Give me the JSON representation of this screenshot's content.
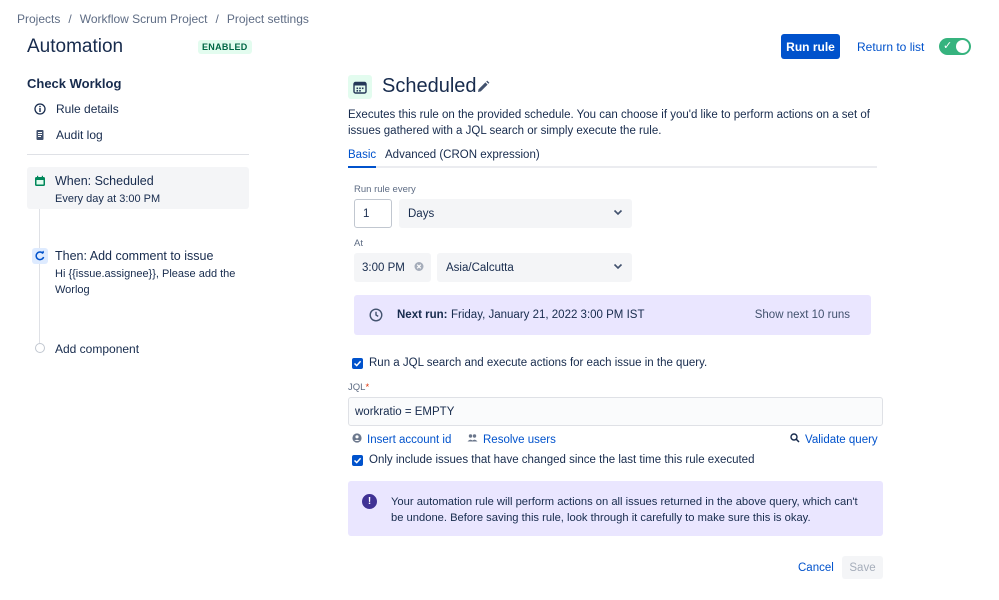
{
  "breadcrumb": [
    "Projects",
    "Workflow Scrum Project",
    "Project settings"
  ],
  "header": {
    "title": "Automation",
    "badge": "ENABLED",
    "run_rule": "Run rule",
    "return_to_list": "Return to list",
    "toggle_on": true
  },
  "sidebar": {
    "rule_name": "Check Worklog",
    "links": [
      {
        "label": "Rule details",
        "icon": "info-icon"
      },
      {
        "label": "Audit log",
        "icon": "document-icon"
      }
    ],
    "steps": [
      {
        "title": "When: Scheduled",
        "subtitle": "Every day at 3:00 PM",
        "icon": "calendar-icon"
      },
      {
        "title": "Then: Add comment to issue",
        "subtitle": "Hi {{issue.assignee}}, Please add the Worlog",
        "icon": "comment-refresh-icon"
      }
    ],
    "add_component": "Add component"
  },
  "main": {
    "title": "Scheduled",
    "description": "Executes this rule on the provided schedule. You can choose if you'd like to perform actions on a set of issues gathered with a JQL search or simply execute the rule.",
    "tabs": [
      {
        "label": "Basic",
        "active": true
      },
      {
        "label": "Advanced (CRON expression)",
        "active": false
      }
    ],
    "run_every_label": "Run rule every",
    "run_every_value": "1",
    "run_every_unit": "Days",
    "at_label": "At",
    "at_time": "3:00 PM",
    "timezone": "Asia/Calcutta",
    "next_run": {
      "label": "Next run:",
      "value": "Friday, January 21, 2022 3:00 PM IST",
      "show_next": "Show next 10 runs"
    },
    "jql_checkbox": "Run a JQL search and execute actions for each issue in the query.",
    "jql_label": "JQL",
    "jql_required": "*",
    "jql_value": "workratio = EMPTY",
    "insert_account_id": "Insert account id",
    "resolve_users": "Resolve users",
    "validate_query": "Validate query",
    "only_changed_checkbox": "Only include issues that have changed since the last time this rule executed",
    "warning": "Your automation rule will perform actions on all issues returned in the above query, which can't be undone. Before saving this rule, look through it carefully to make sure this is okay.",
    "cancel": "Cancel",
    "save": "Save"
  },
  "colors": {
    "primary": "#0052cc",
    "success": "#36b37e",
    "info_panel": "#eae6ff",
    "warning_icon": "#403294"
  }
}
